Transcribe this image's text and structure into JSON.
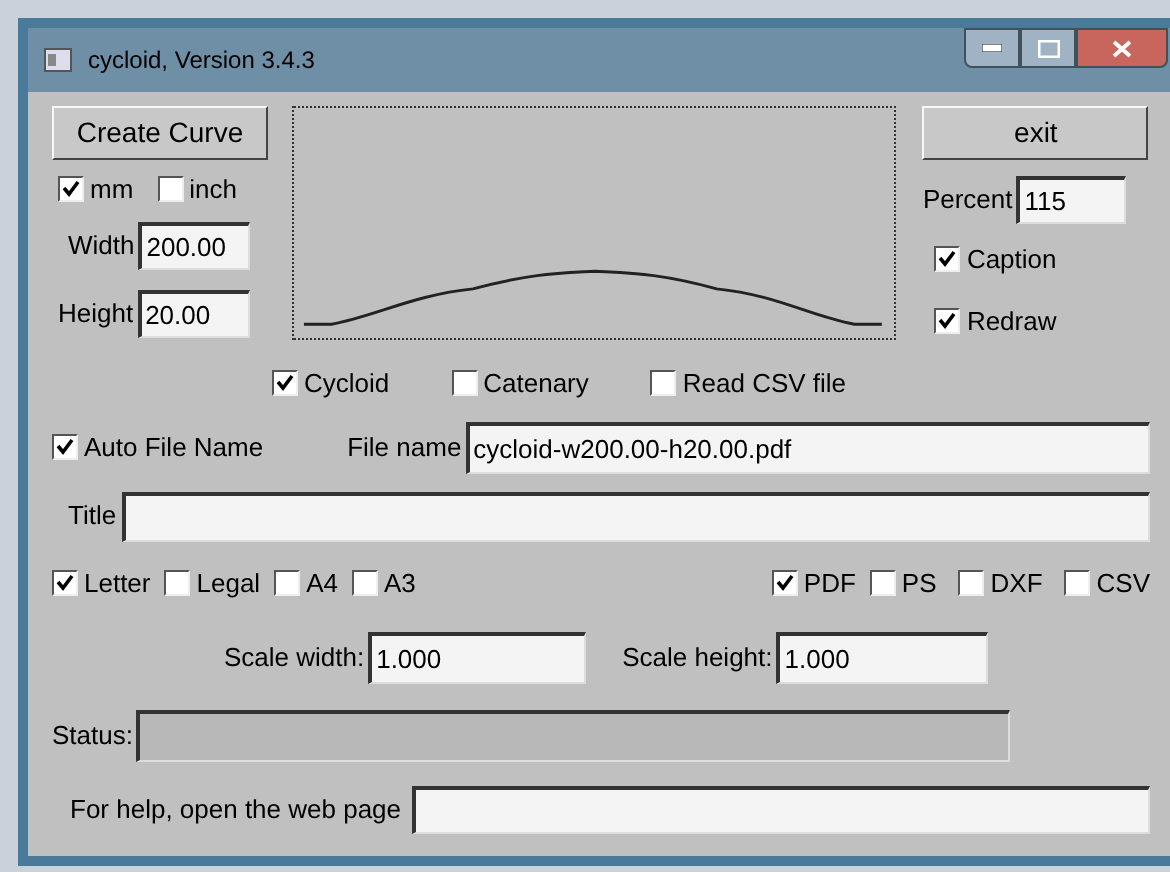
{
  "window": {
    "title": "cycloid, Version 3.4.3"
  },
  "create_button": "Create Curve",
  "exit_button": "exit",
  "units": [
    {
      "label": "mm",
      "checked": true
    },
    {
      "label": "inch",
      "checked": false
    }
  ],
  "width": {
    "label": "Width",
    "value": "200.00"
  },
  "height": {
    "label": "Height",
    "value": "20.00"
  },
  "percent": {
    "label": "Percent",
    "value": "115"
  },
  "display_options": [
    {
      "label": "Caption",
      "checked": true
    },
    {
      "label": "Redraw",
      "checked": true
    }
  ],
  "curve_types": [
    {
      "label": "Cycloid",
      "checked": true
    },
    {
      "label": "Catenary",
      "checked": false
    },
    {
      "label": "Read CSV file",
      "checked": false
    }
  ],
  "auto_file_name": {
    "label": "Auto File Name",
    "checked": true
  },
  "file_name": {
    "label": "File name",
    "value": "cycloid-w200.00-h20.00.pdf"
  },
  "title_field": {
    "label": "Title"
  },
  "paper_sizes": [
    {
      "label": "Letter",
      "checked": true
    },
    {
      "label": "Legal",
      "checked": false
    },
    {
      "label": "A4",
      "checked": false
    },
    {
      "label": "A3",
      "checked": false
    }
  ],
  "formats": [
    {
      "label": "PDF",
      "checked": true
    },
    {
      "label": "PS",
      "checked": false
    },
    {
      "label": "DXF",
      "checked": false
    },
    {
      "label": "CSV",
      "checked": false
    }
  ],
  "scale_width": {
    "label": "Scale width:",
    "value": "1.000"
  },
  "scale_height": {
    "label": "Scale height:",
    "value": "1.000"
  },
  "status": {
    "label": "Status:",
    "disabled": true
  },
  "help": {
    "label": "For help, open the web page"
  }
}
